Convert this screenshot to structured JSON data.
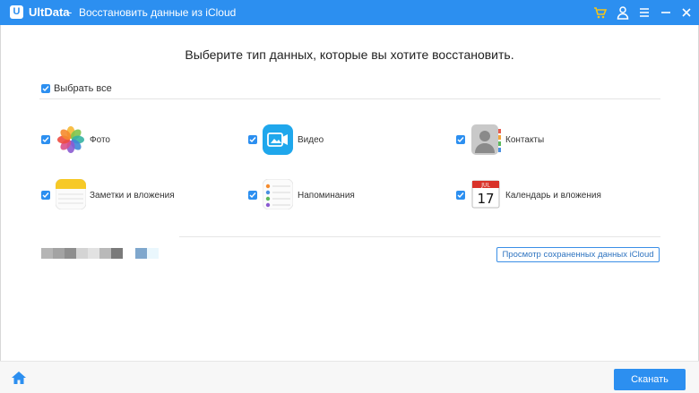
{
  "titlebar": {
    "logo_letter": "U",
    "app_name": "UltData",
    "separator": "-",
    "title": "Восстановить данные из iCloud"
  },
  "headline": "Выберите тип данных, которые вы хотите восстановить.",
  "select_all": {
    "label": "Выбрать все",
    "checked": true
  },
  "categories": [
    {
      "label": "Фото",
      "icon": "photos-icon",
      "checked": true
    },
    {
      "label": "Видео",
      "icon": "video-icon",
      "checked": true
    },
    {
      "label": "Контакты",
      "icon": "contacts-icon",
      "checked": true
    },
    {
      "label": "Заметки и вложения",
      "icon": "notes-icon",
      "checked": true
    },
    {
      "label": "Напоминания",
      "icon": "reminders-icon",
      "checked": true
    },
    {
      "label": "Календарь и вложения",
      "icon": "calendar-icon",
      "checked": true
    }
  ],
  "calendar_icon": {
    "month": "JUL",
    "day": "17"
  },
  "view_saved_button": "Просмотр сохраненных данных iCloud",
  "scan_button": "Сканать",
  "colors": {
    "accent": "#2c8ff0",
    "titlebar": "#2c8ff0",
    "cart": "#f5c518"
  }
}
